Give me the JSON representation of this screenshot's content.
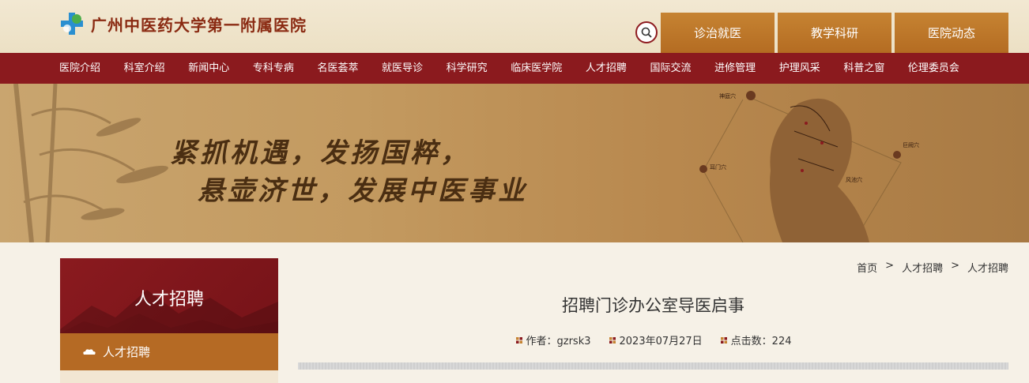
{
  "header": {
    "logo_text": "广州中医药大学第一附属医院",
    "top_tabs": [
      "诊治就医",
      "教学科研",
      "医院动态"
    ]
  },
  "nav": {
    "items": [
      "医院介绍",
      "科室介绍",
      "新闻中心",
      "专科专病",
      "名医荟萃",
      "就医导诊",
      "科学研究",
      "临床医学院",
      "人才招聘",
      "国际交流",
      "进修管理",
      "护理风采",
      "科普之窗",
      "伦理委员会"
    ]
  },
  "banner": {
    "line1": "紧抓机遇，发扬国粹，",
    "line2": "悬壶济世，发展中医事业",
    "acupoints": [
      "神庭穴",
      "耳门穴",
      "巨阙穴",
      "风池穴"
    ]
  },
  "sidebar": {
    "title": "人才招聘",
    "active_item": "人才招聘"
  },
  "breadcrumb": [
    "首页",
    ">",
    "人才招聘",
    ">",
    "人才招聘"
  ],
  "article": {
    "title": "招聘门诊办公室导医启事",
    "author": "作者：gzrsk3",
    "date": "2023年07月27日",
    "views": "点击数：224"
  },
  "colors": {
    "nav_red": "#8b1a1e",
    "tab_orange": "#c68332",
    "logo_red": "#8a2a12"
  }
}
